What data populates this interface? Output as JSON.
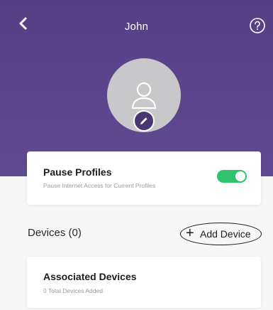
{
  "header": {
    "title": "John",
    "back_icon": "chevron-left-icon",
    "help_icon": "question-circle-icon",
    "background_color": "#5a4389"
  },
  "profile": {
    "avatar_icon": "user-outline-icon",
    "edit_icon": "pencil-icon"
  },
  "pause_profiles": {
    "title": "Pause Profiles",
    "subtitle": "Pause Internet Access for Current Profiles",
    "toggle_on": true,
    "toggle_color": "#2fc36b"
  },
  "devices": {
    "label": "Devices (0)",
    "add_button": {
      "plus": "+",
      "label": "Add Device"
    }
  },
  "associated_devices": {
    "title": "Associated Devices",
    "subtitle": "0 Total Devices Added"
  }
}
